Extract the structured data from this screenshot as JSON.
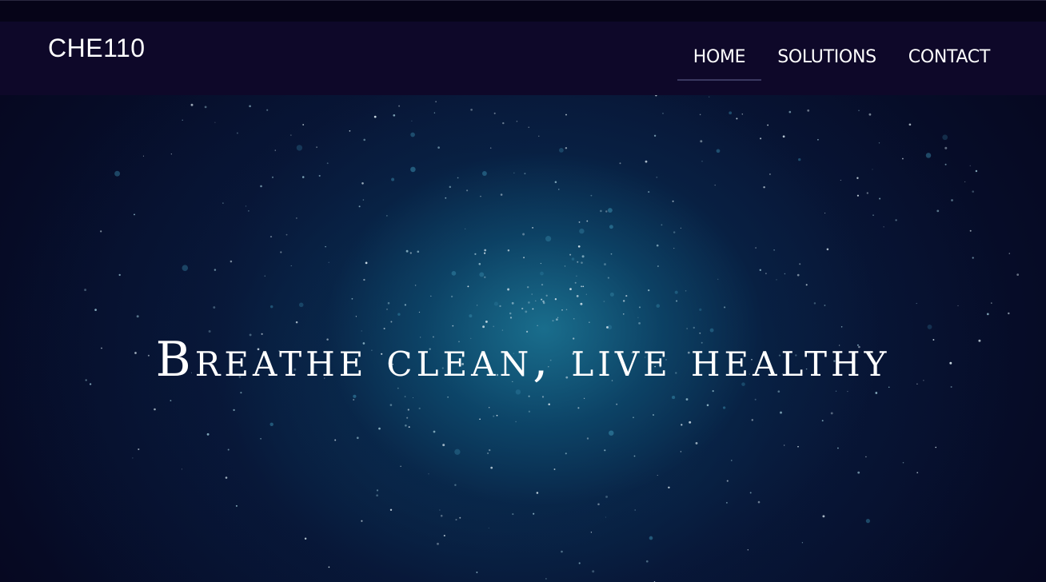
{
  "header": {
    "brand": "CHE110",
    "nav": [
      {
        "label": "HOME",
        "active": true
      },
      {
        "label": "SOLUTIONS",
        "active": false
      },
      {
        "label": "CONTACT",
        "active": false
      }
    ]
  },
  "hero": {
    "title": "Breathe clean, live healthy",
    "background": "starfield-particles"
  },
  "colors": {
    "navbar": "#0e0829",
    "page_background": "#05041a",
    "hero_glow": "#1c7896",
    "text": "#ffffff"
  }
}
